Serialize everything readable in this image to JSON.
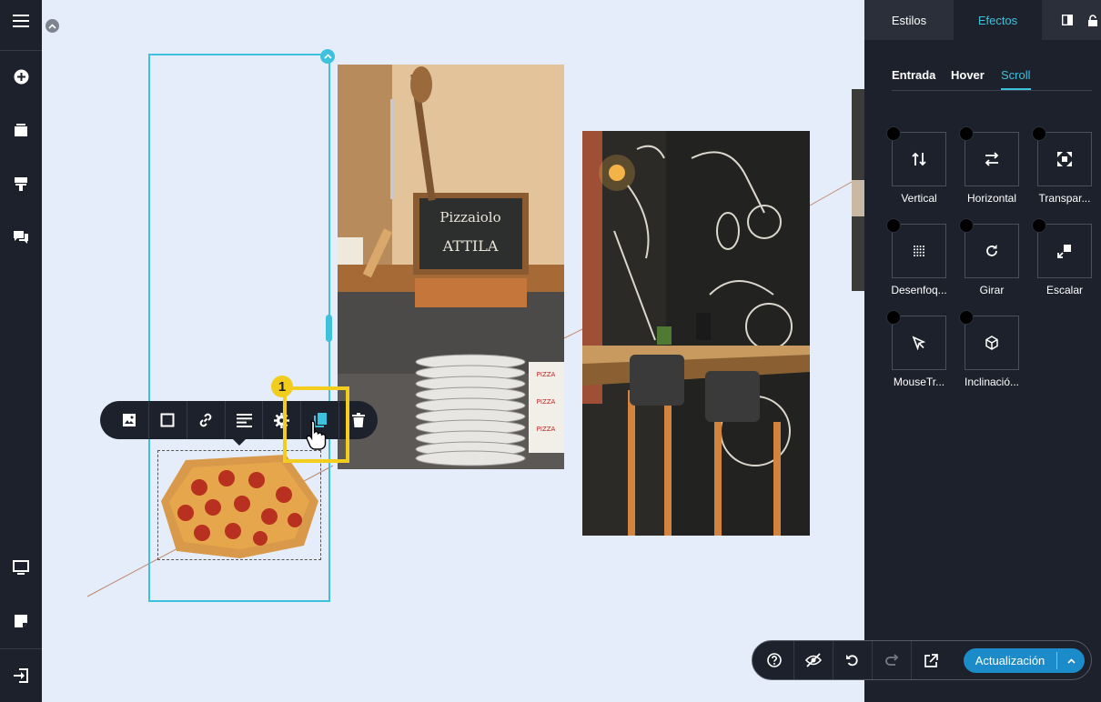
{
  "right_panel": {
    "tabs": {
      "estilos": "Estilos",
      "efectos": "Efectos"
    },
    "subtabs": {
      "entrada": "Entrada",
      "hover": "Hover",
      "scroll": "Scroll"
    },
    "effects": [
      {
        "label": "Vertical",
        "icon": "arrows-vertical-icon"
      },
      {
        "label": "Horizontal",
        "icon": "arrows-horizontal-icon"
      },
      {
        "label": "Transpar...",
        "icon": "transparency-icon"
      },
      {
        "label": "Desenfoq...",
        "icon": "blur-icon"
      },
      {
        "label": "Girar",
        "icon": "rotate-icon"
      },
      {
        "label": "Escalar",
        "icon": "scale-icon"
      },
      {
        "label": "MouseTr...",
        "icon": "cursor-icon"
      },
      {
        "label": "Inclinació...",
        "icon": "cube-icon"
      }
    ]
  },
  "canvas": {
    "step_badge": "1",
    "photo_texts": {
      "chalkboard": "Pizzaiolo ATTILA",
      "pizza_box": "PIZZA"
    }
  },
  "bottom_bar": {
    "update_label": "Actualización"
  },
  "colors": {
    "accent": "#3ec1dd",
    "highlight": "#f2cd1e",
    "update": "#1c8bc9",
    "panel": "#1d212b"
  }
}
